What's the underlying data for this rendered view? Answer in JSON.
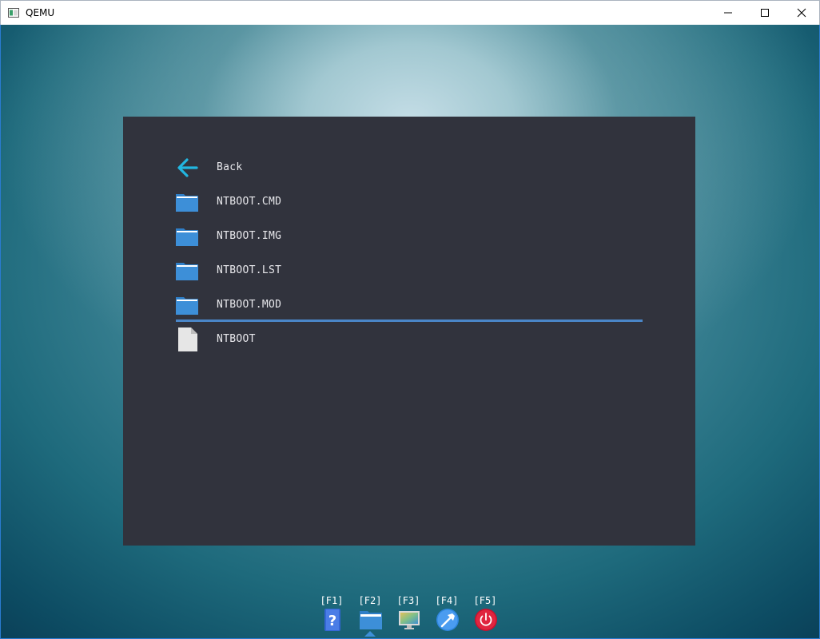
{
  "window": {
    "title": "QEMU",
    "icon": "qemu-window-icon",
    "controls": {
      "minimize": "minimize-icon",
      "maximize": "maximize-icon",
      "close": "close-icon"
    }
  },
  "file_browser": {
    "items": [
      {
        "label": "Back",
        "icon": "back-arrow-icon"
      },
      {
        "label": "NTBOOT.CMD",
        "icon": "folder-icon"
      },
      {
        "label": "NTBOOT.IMG",
        "icon": "folder-icon"
      },
      {
        "label": "NTBOOT.LST",
        "icon": "folder-icon"
      },
      {
        "label": "NTBOOT.MOD",
        "icon": "folder-icon"
      },
      {
        "label": "NTBOOT",
        "icon": "file-icon"
      }
    ],
    "selected_index": 4
  },
  "dock": {
    "items": [
      {
        "key": "[F1]",
        "icon": "help-icon"
      },
      {
        "key": "[F2]",
        "icon": "file-manager-icon",
        "active": true
      },
      {
        "key": "[F3]",
        "icon": "display-icon"
      },
      {
        "key": "[F4]",
        "icon": "tools-icon"
      },
      {
        "key": "[F5]",
        "icon": "power-icon"
      }
    ]
  },
  "colors": {
    "panel": "#31333d",
    "accent": "#4a86c8",
    "folder": "#3d8fd8",
    "back_arrow": "#22b6e0"
  }
}
